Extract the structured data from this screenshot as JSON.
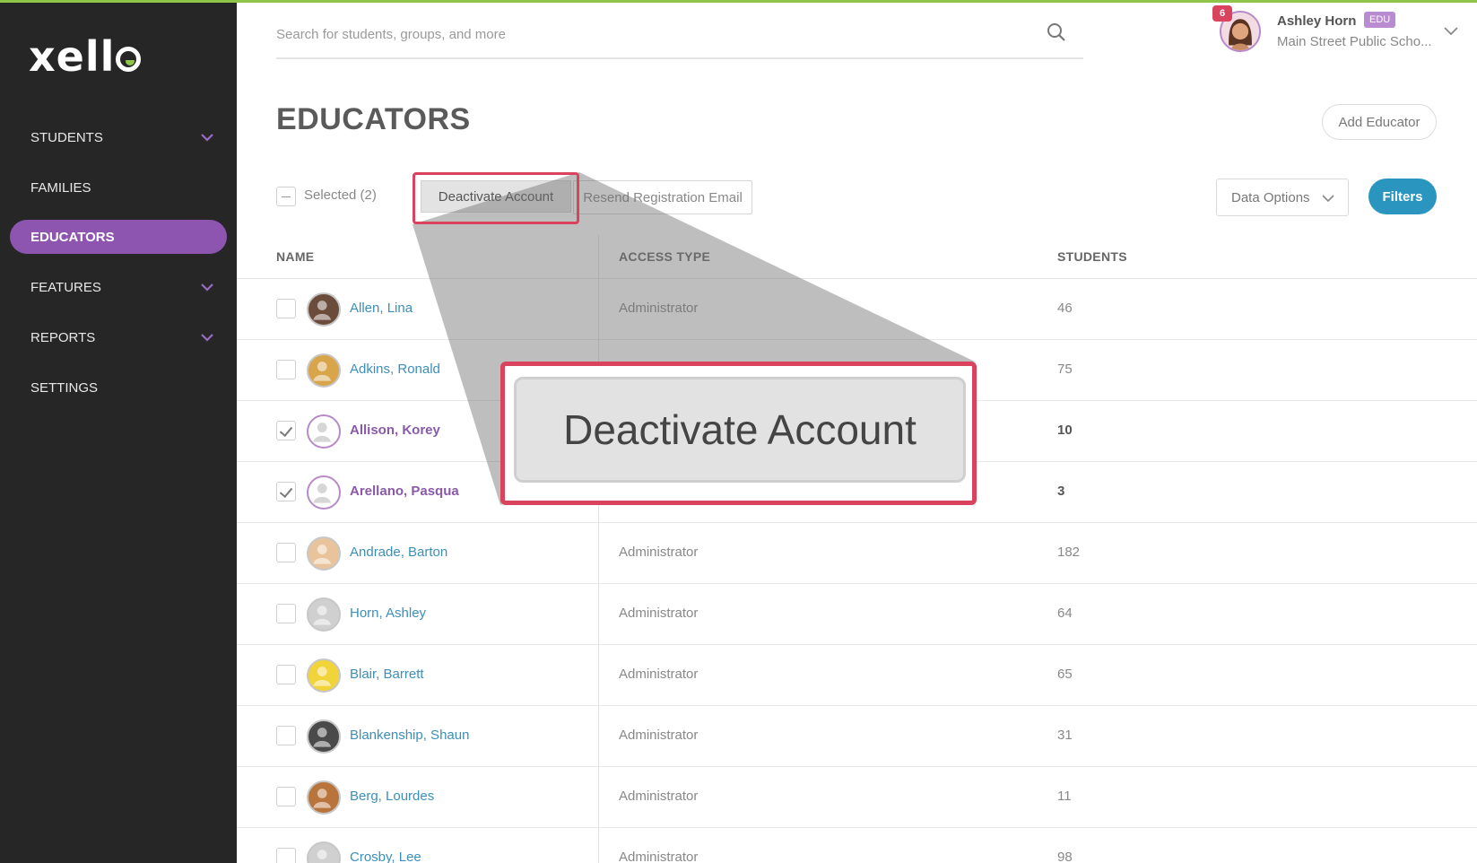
{
  "app": {
    "logo_text": "xell",
    "accent_color": "#8e55b0",
    "brand_green": "#8fc64a"
  },
  "sidebar": {
    "items": [
      {
        "label": "STUDENTS",
        "has_chevron": true
      },
      {
        "label": "FAMILIES",
        "has_chevron": false
      },
      {
        "label": "EDUCATORS",
        "has_chevron": false,
        "active": true
      },
      {
        "label": "FEATURES",
        "has_chevron": true
      },
      {
        "label": "REPORTS",
        "has_chevron": true
      },
      {
        "label": "SETTINGS",
        "has_chevron": false
      }
    ]
  },
  "search": {
    "placeholder": "Search for students, groups, and more",
    "icon": "search-icon"
  },
  "user": {
    "name": "Ashley Horn",
    "badge": "EDU",
    "school": "Main Street Public Scho...",
    "notification_count": "6"
  },
  "page": {
    "title": "EDUCATORS",
    "add_button": "Add Educator"
  },
  "toolbar": {
    "selected_label": "Selected (2)",
    "deactivate_label": "Deactivate Account",
    "resend_label": "Resend Registration Email",
    "data_options_label": "Data Options",
    "filters_label": "Filters",
    "filters_color": "#2a96bf"
  },
  "table": {
    "columns": [
      "NAME",
      "ACCESS TYPE",
      "STUDENTS"
    ],
    "rows": [
      {
        "name": "Allen, Lina",
        "access": "Administrator",
        "students": "46",
        "checked": false
      },
      {
        "name": "Adkins, Ronald",
        "access": "",
        "students": "75",
        "checked": false
      },
      {
        "name": "Allison, Korey",
        "access": "",
        "students": "10",
        "checked": true
      },
      {
        "name": "Arellano, Pasqua",
        "access": "",
        "students": "3",
        "checked": true
      },
      {
        "name": "Andrade, Barton",
        "access": "Administrator",
        "students": "182",
        "checked": false
      },
      {
        "name": "Horn, Ashley",
        "access": "Administrator",
        "students": "64",
        "checked": false
      },
      {
        "name": "Blair, Barrett",
        "access": "Administrator",
        "students": "65",
        "checked": false
      },
      {
        "name": "Blankenship, Shaun",
        "access": "Administrator",
        "students": "31",
        "checked": false
      },
      {
        "name": "Berg, Lourdes",
        "access": "Administrator",
        "students": "11",
        "checked": false
      },
      {
        "name": "Crosby, Lee",
        "access": "Administrator",
        "students": "98",
        "checked": false
      }
    ]
  },
  "callout": {
    "zoom_label": "Deactivate Account",
    "highlight_color": "#d9435d"
  }
}
